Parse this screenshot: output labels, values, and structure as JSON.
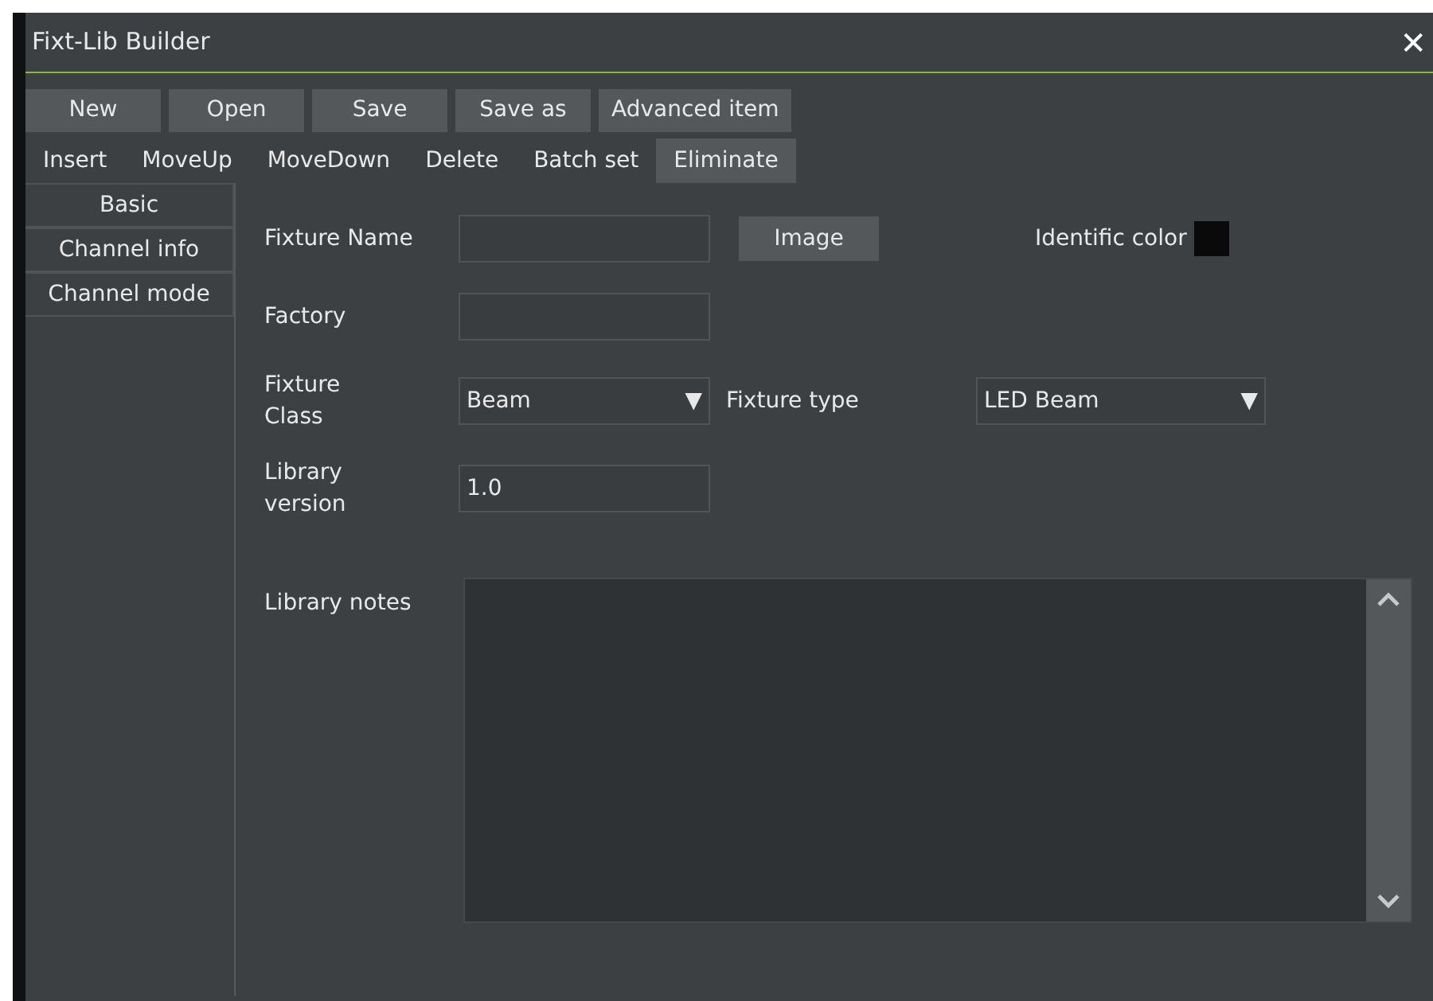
{
  "window": {
    "title": "Fixt-Lib Builder",
    "close": "✕"
  },
  "toolbar": [
    {
      "label": "New"
    },
    {
      "label": "Open"
    },
    {
      "label": "Save"
    },
    {
      "label": "Save as"
    },
    {
      "label": "Advanced item"
    }
  ],
  "actions": [
    {
      "label": "Insert",
      "highlighted": false
    },
    {
      "label": "MoveUp",
      "highlighted": false
    },
    {
      "label": "MoveDown",
      "highlighted": false
    },
    {
      "label": "Delete",
      "highlighted": false
    },
    {
      "label": "Batch set",
      "highlighted": false
    },
    {
      "label": "Eliminate",
      "highlighted": true
    }
  ],
  "sidebar": {
    "items": [
      {
        "label": "Basic"
      },
      {
        "label": "Channel info"
      },
      {
        "label": "Channel mode"
      }
    ]
  },
  "form": {
    "fixture_name": {
      "label": "Fixture Name"
    },
    "image_button": "Image",
    "identific_color": {
      "label": "Identific color",
      "color": "#0a0a0a"
    },
    "factory": {
      "label": "Factory"
    },
    "fixture_class": {
      "label": "Fixture\nClass",
      "value": "Beam",
      "arrow": "▼"
    },
    "fixture_type": {
      "label": "Fixture type",
      "value": "LED Beam",
      "arrow": "▼"
    },
    "library_version": {
      "label": "Library\nversion",
      "value": "1.0"
    },
    "library_notes": {
      "label": "Library notes"
    }
  }
}
